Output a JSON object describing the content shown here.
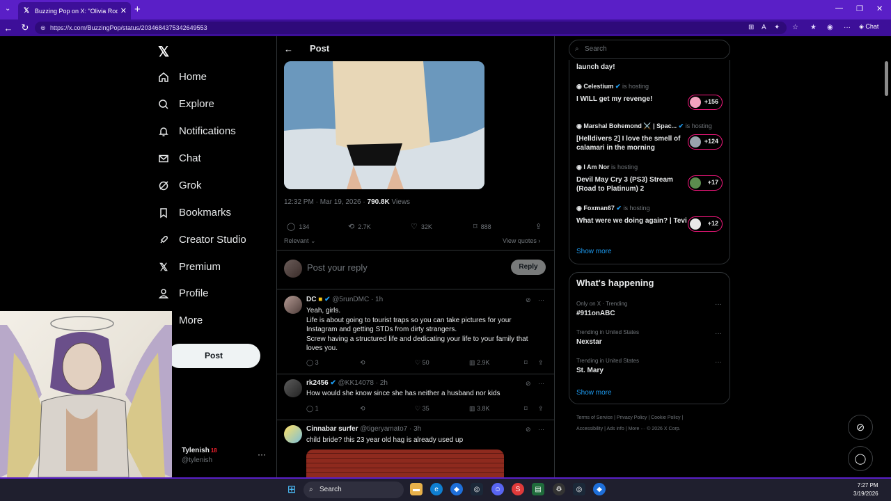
{
  "browser": {
    "tab_title": "Buzzing Pop on X: \"Olivia Rodrigo",
    "url": "https://x.com/BuzzingPop/status/2034684375342649553",
    "chat_label": "Chat"
  },
  "nav": {
    "items": [
      {
        "label": "Home",
        "icon": "home-icon"
      },
      {
        "label": "Explore",
        "icon": "search-icon"
      },
      {
        "label": "Notifications",
        "icon": "bell-icon"
      },
      {
        "label": "Chat",
        "icon": "mail-icon"
      },
      {
        "label": "Grok",
        "icon": "grok-icon"
      },
      {
        "label": "Bookmarks",
        "icon": "bookmark-icon"
      },
      {
        "label": "Creator Studio",
        "icon": "rocket-icon"
      },
      {
        "label": "Premium",
        "icon": "x-icon"
      },
      {
        "label": "Profile",
        "icon": "person-icon"
      },
      {
        "label": "More",
        "icon": "more-icon"
      }
    ],
    "post_button": "Post",
    "account": {
      "name": "Tylenish",
      "badge": "18",
      "handle": "@tylenish"
    }
  },
  "post": {
    "header": "Post",
    "time": "12:32 PM · Mar 19, 2026 · ",
    "views_count": "790.8K",
    "views_label": " Views",
    "actions": {
      "replies": "134",
      "reposts": "2.7K",
      "likes": "32K",
      "bookmarks": "888"
    },
    "sort_label": "Relevant",
    "view_quotes": "View quotes",
    "reply_placeholder": "Post your reply",
    "reply_button": "Reply"
  },
  "replies": [
    {
      "name": "DC",
      "handle": "@5runDMC · 1h",
      "lines": [
        "Yeah, girls.",
        "Life is about going to tourist traps so you can take pictures for your Instagram and getting STDs from dirty strangers.",
        "Screw having a structured life and dedicating your life to your family that loves you."
      ],
      "replies": "3",
      "likes": "50",
      "views": "2.9K"
    },
    {
      "name": "rk2456",
      "handle": "@KK14078 · 2h",
      "lines": [
        "How would she know since she has neither a husband nor kids"
      ],
      "replies": "1",
      "likes": "35",
      "views": "3.8K"
    },
    {
      "name": "Cinnabar surfer",
      "handle": "@tigeryamato7 · 3h",
      "lines": [
        "child bride? this 23 year old hag is already used up"
      ]
    }
  ],
  "right": {
    "search_placeholder": "Search",
    "top_title": "launch day!",
    "spaces": [
      {
        "host": "Celestium",
        "status": "is hosting",
        "title": "I WILL get my revenge!",
        "count": "+156"
      },
      {
        "host": "Marshal Bohemond ⚔️ | Spac...",
        "status": "is hosting",
        "title": "[Helldivers 2] I love the smell of calamari in the morning",
        "count": "+124"
      },
      {
        "host": "I Am Nor",
        "status": "is hosting",
        "title": "Devil May Cry 3 (PS3) Stream (Road to Platinum) 2",
        "count": "+17"
      },
      {
        "host": "Foxman67",
        "status": "is hosting",
        "title": "What were we doing again? | Tevi",
        "count": "+12"
      }
    ],
    "show_more": "Show more",
    "happening_title": "What's happening",
    "trends": [
      {
        "context": "Only on X · Trending",
        "name": "#911onABC"
      },
      {
        "context": "Trending in United States",
        "name": "Nexstar"
      },
      {
        "context": "Trending in United States",
        "name": "St. Mary"
      }
    ],
    "footer_line1": "Terms of Service  |  Privacy Policy  |  Cookie Policy  |",
    "footer_line2": "Accessibility  |  Ads info  |  More ···  © 2026 X Corp."
  },
  "taskbar": {
    "search_label": "Search",
    "time": "7:27 PM",
    "date": "3/19/2026"
  }
}
